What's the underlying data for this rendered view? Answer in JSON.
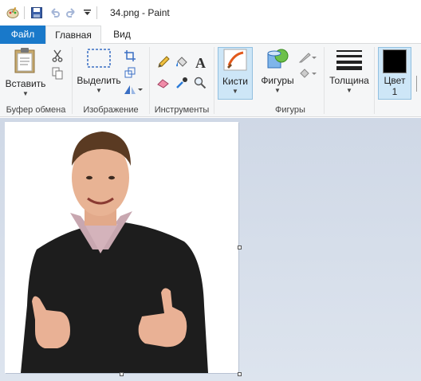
{
  "window": {
    "title": "34.png - Paint"
  },
  "tabs": [
    {
      "label": "Файл"
    },
    {
      "label": "Главная"
    },
    {
      "label": "Вид"
    }
  ],
  "ribbon": {
    "clipboard": {
      "paste_label": "Вставить",
      "group_label": "Буфер обмена"
    },
    "image": {
      "select_label": "Выделить",
      "group_label": "Изображение"
    },
    "tools": {
      "group_label": "Инструменты"
    },
    "brushes": {
      "label": "Кисти"
    },
    "shapes": {
      "label": "Фигуры",
      "group_label": "Фигуры"
    },
    "size": {
      "label": "Толщина"
    },
    "color1": {
      "label_line1": "Цвет",
      "label_line2": "1",
      "value": "#000000"
    }
  },
  "colors": {
    "file_tab": "#1979ca",
    "selected_button": "#cde6f7",
    "workspace": "#cfd8e6"
  }
}
